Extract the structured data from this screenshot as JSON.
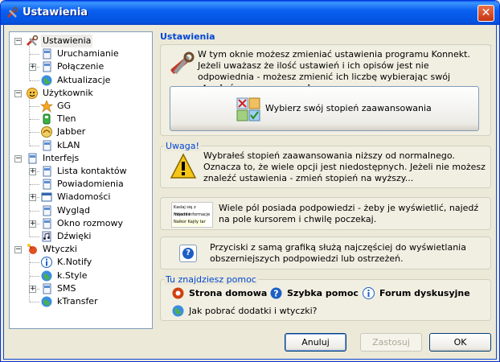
{
  "window": {
    "title": "Ustawienia",
    "close_glyph": "✕"
  },
  "tree": {
    "items": [
      {
        "label": "Ustawienia",
        "icon": "tools-icon",
        "level": 0,
        "toggle": "−",
        "selected": true
      },
      {
        "label": "Uruchamianie",
        "icon": "page-icon",
        "level": 1,
        "toggle": ""
      },
      {
        "label": "Połączenie",
        "icon": "page-icon",
        "level": 1,
        "toggle": "+"
      },
      {
        "label": "Aktualizacje",
        "icon": "globe-icon",
        "level": 1,
        "toggle": ""
      },
      {
        "label": "Użytkownik",
        "icon": "user-icon",
        "level": 0,
        "toggle": "−"
      },
      {
        "label": "GG",
        "icon": "gg-icon",
        "level": 1,
        "toggle": ""
      },
      {
        "label": "Tlen",
        "icon": "tlen-icon",
        "level": 1,
        "toggle": ""
      },
      {
        "label": "Jabber",
        "icon": "jabber-icon",
        "level": 1,
        "toggle": ""
      },
      {
        "label": "kLAN",
        "icon": "page-icon",
        "level": 1,
        "toggle": ""
      },
      {
        "label": "Interfejs",
        "icon": "page-icon",
        "level": 0,
        "toggle": "−"
      },
      {
        "label": "Lista kontaktów",
        "icon": "page-icon",
        "level": 1,
        "toggle": "+"
      },
      {
        "label": "Powiadomienia",
        "icon": "page-icon",
        "level": 1,
        "toggle": ""
      },
      {
        "label": "Wiadomości",
        "icon": "window-icon",
        "level": 1,
        "toggle": "+"
      },
      {
        "label": "Wygląd",
        "icon": "page-icon",
        "level": 1,
        "toggle": ""
      },
      {
        "label": "Okno rozmowy",
        "icon": "page-icon",
        "level": 1,
        "toggle": "+"
      },
      {
        "label": "Dźwięki",
        "icon": "sound-icon",
        "level": 1,
        "toggle": ""
      },
      {
        "label": "Wtyczki",
        "icon": "plugin-icon",
        "level": 0,
        "toggle": "−"
      },
      {
        "label": "K.Notify",
        "icon": "info-icon",
        "level": 1,
        "toggle": ""
      },
      {
        "label": "k.Style",
        "icon": "globe-icon",
        "level": 1,
        "toggle": ""
      },
      {
        "label": "SMS",
        "icon": "page-icon",
        "level": 1,
        "toggle": "+"
      },
      {
        "label": "kTransfer",
        "icon": "globe-icon",
        "level": 1,
        "toggle": ""
      }
    ]
  },
  "panel": {
    "heading": "Ustawienia",
    "intro_text": "W tym oknie możesz zmieniać ustawienia programu Konnekt. Jeżeli uważasz że ilość ustawień i ich opisów jest nie odpowiednia - możesz zmienić ich liczbę wybierając swój ",
    "intro_bold": "stopień zaawansowania",
    "intro_end": ".",
    "level_button": "Wybierz swój stopień zaawansowania",
    "warning_title": "Uwaga!",
    "warning_text": "Wybrałeś stopień zaawansowania niższy od normalnego. Oznacza to, że wiele opcji jest niedostępnych. Jeżeli nie możesz znaleźć ustawienia - zmień stopień na wyższy...",
    "tooltip_text": "Wiele pól posiada podpowiedzi - żeby je wyświetlić, najedź na pole kursorem i chwilę poczekaj.",
    "tooltip_thumb_lines": [
      "Kaslaj się z mhomie",
      "Najedź informacje",
      "Nalkor Kajily tar"
    ],
    "help_buttons_text": "Przyciski z samą grafiką służą najczęściej do wyświetlania obszerniejszych podpowiedzi lub ostrzeżeń.",
    "help_glyph": "?",
    "links_title": "Tu znajdziesz pomoc",
    "link_home": "Strona domowa",
    "link_quick": "Szybka pomoc",
    "link_forum": "Forum dyskusyjne",
    "link_addons": "Jak pobrać dodatki i wtyczki?"
  },
  "buttons": {
    "cancel": "Anuluj",
    "apply": "Zastosuj",
    "ok": "OK"
  }
}
